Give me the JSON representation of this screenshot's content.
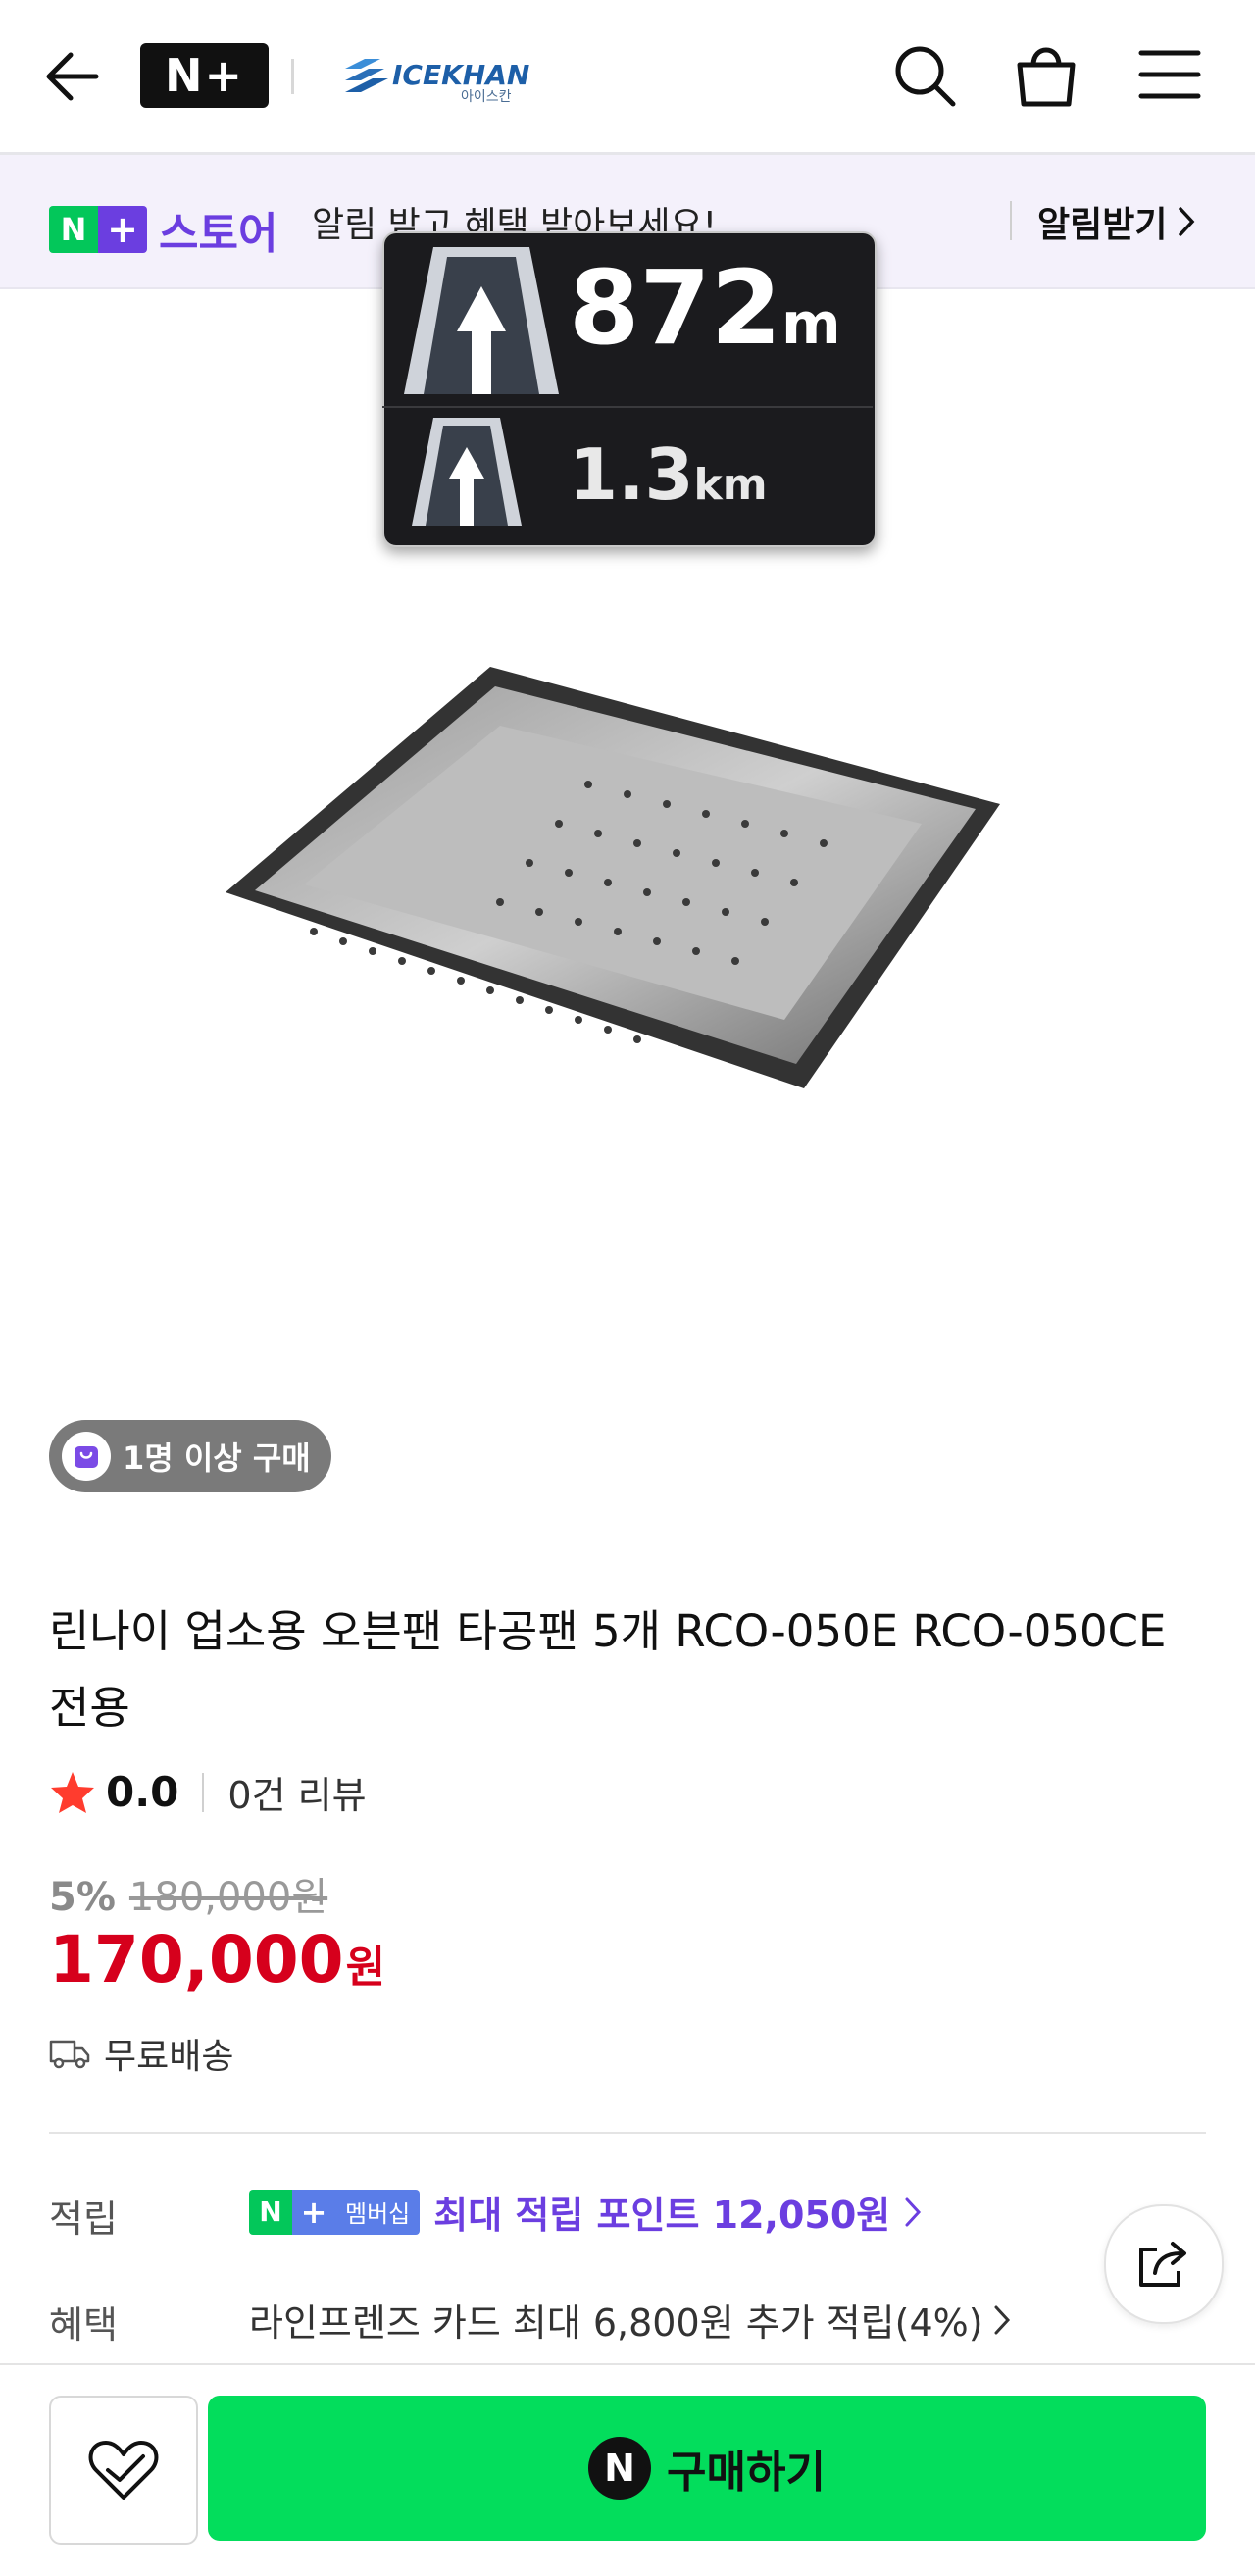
{
  "header": {
    "logo_text": "N+",
    "brand_name": "ICEKHAN",
    "brand_sub": "아이스칸"
  },
  "banner": {
    "badge_n": "N",
    "badge_plus": "+",
    "store_label": "스토어",
    "message": "알림 받고 혜택 받아보세요!",
    "notify_label": "알림받기"
  },
  "nav_overlay": {
    "next_distance": "872",
    "next_unit": "m",
    "following_distance": "1.3",
    "following_unit": "km"
  },
  "product": {
    "purchase_badge": "1명 이상 구매",
    "title": "린나이 업소용 오븐팬 타공팬 5개 RCO-050E RCO-050CE 전용",
    "rating": "0.0",
    "review_count": "0건 리뷰",
    "discount_percent": "5%",
    "original_price": "180,000원",
    "price": "170,000",
    "price_unit": "원",
    "shipping": "무료배송"
  },
  "benefits": {
    "points_label": "적립",
    "member_badge": "멤버십",
    "points_text": "최대 적립 포인트 12,050원",
    "benefit_label": "혜택",
    "benefit_text": "라인프렌즈 카드 최대 6,800원 추가 적립(4%)"
  },
  "bottom": {
    "buy_icon": "N",
    "buy_label": "구매하기"
  },
  "colors": {
    "naver_green": "#03c75a",
    "buy_green": "#03dd5c",
    "store_purple": "#6b3ee0",
    "price_red": "#d6001c"
  }
}
